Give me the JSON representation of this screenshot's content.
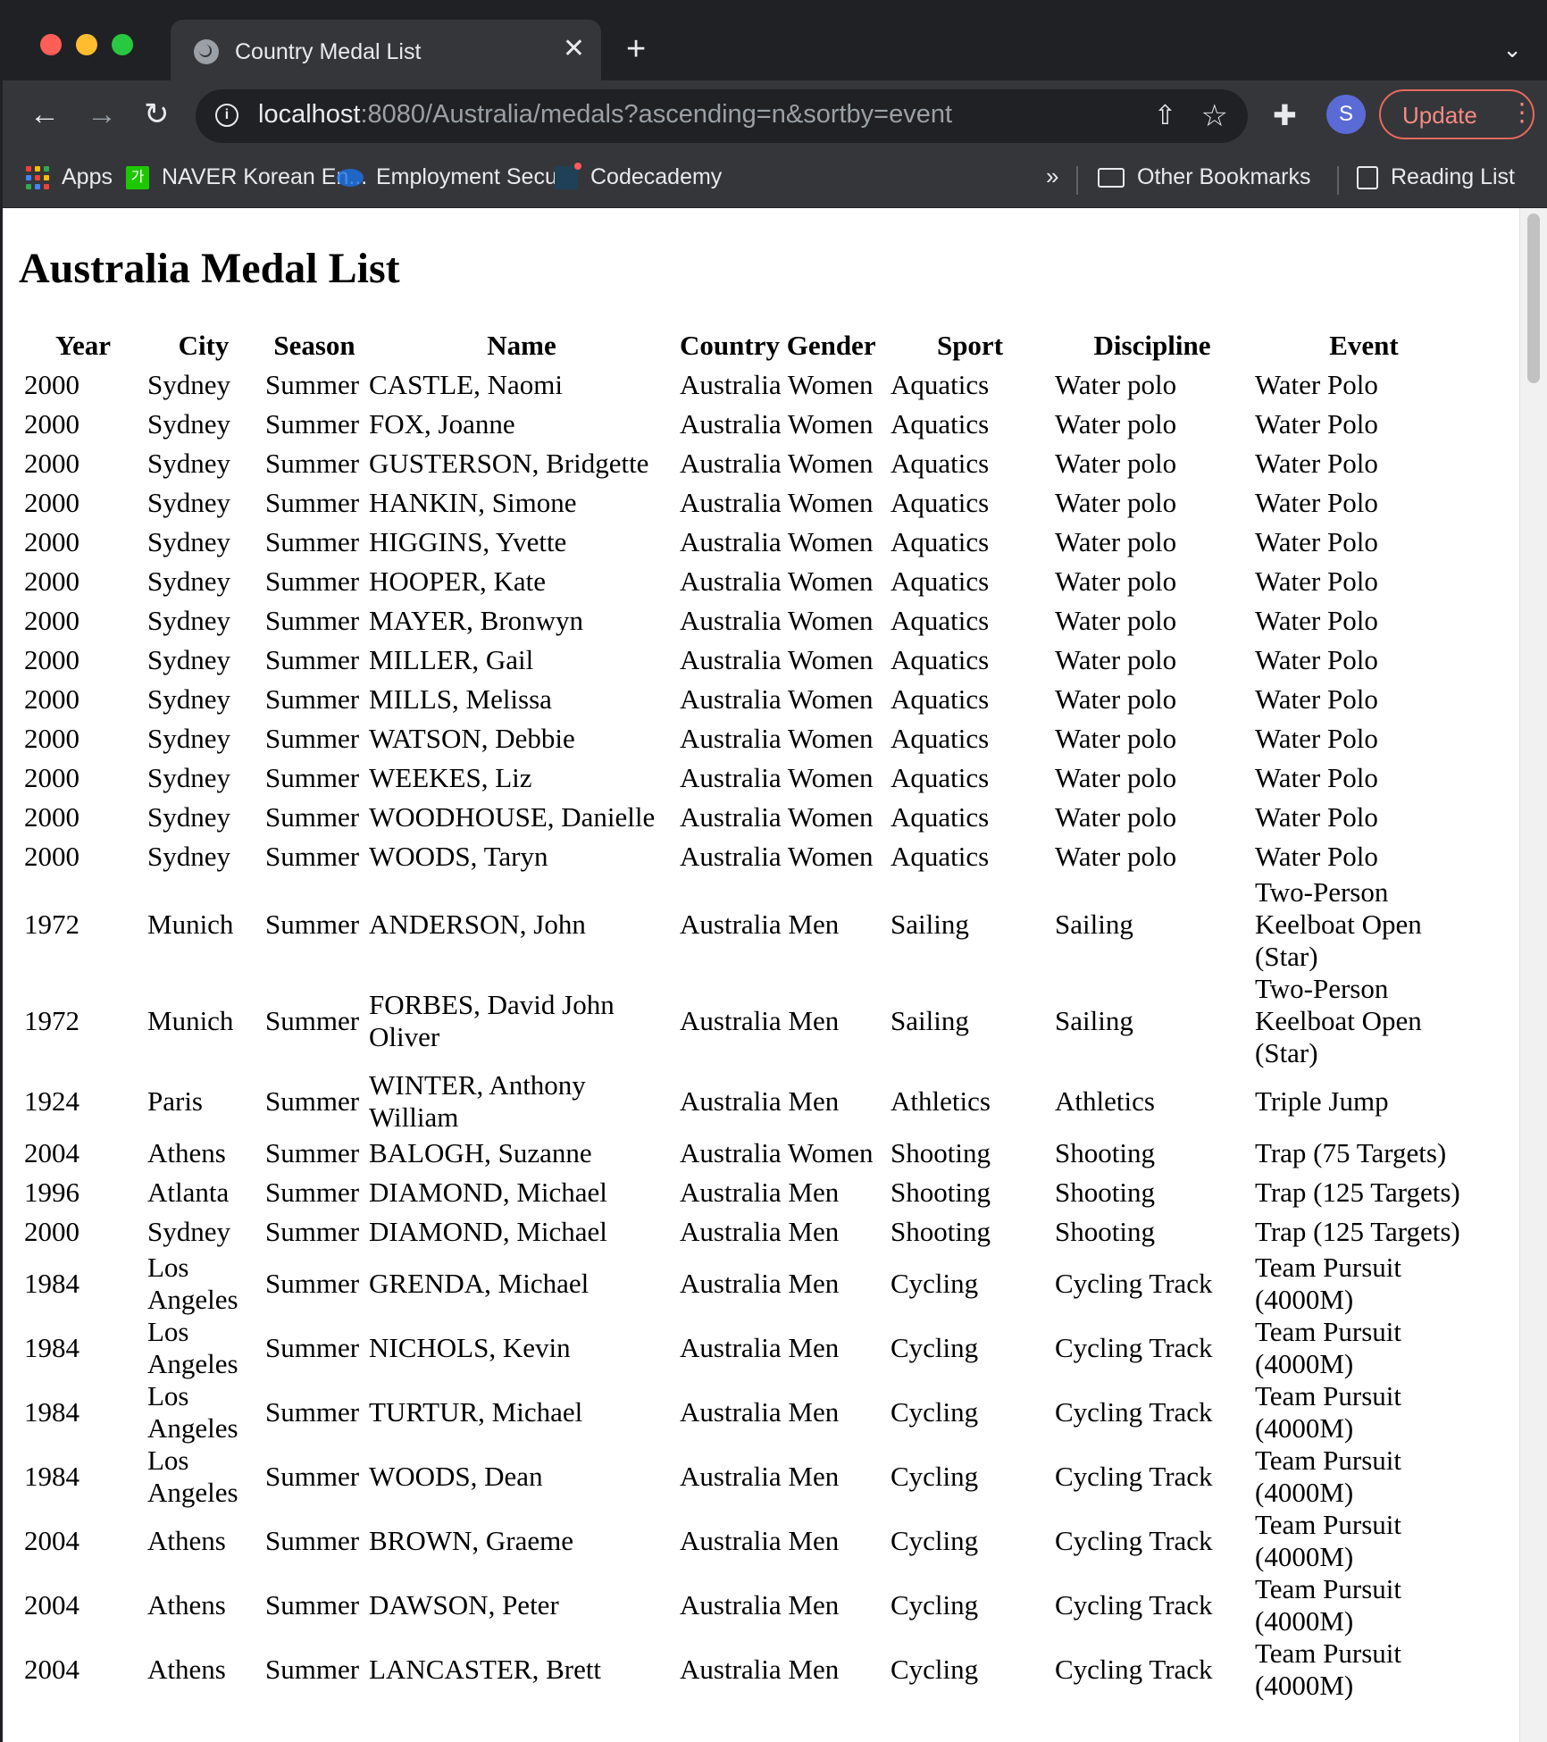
{
  "browser": {
    "tab_title": "Country Medal List",
    "url_host": "localhost",
    "url_rest": ":8080/Australia/medals?ascending=n&sortby=event",
    "avatar_letter": "S",
    "update_label": "Update",
    "bookmarks": {
      "apps": "Apps",
      "naver": "NAVER Korean En...",
      "employment": "Employment Secu...",
      "codecademy": "Codecademy",
      "more": "»",
      "other": "Other Bookmarks",
      "reading": "Reading List"
    }
  },
  "page": {
    "title": "Australia Medal List",
    "columns": [
      "Year",
      "City",
      "Season",
      "Name",
      "Country",
      "Gender",
      "Sport",
      "Discipline",
      "Event"
    ],
    "rows": [
      [
        "2000",
        "Sydney",
        "Summer",
        "CASTLE, Naomi",
        "Australia",
        "Women",
        "Aquatics",
        "Water polo",
        "Water Polo"
      ],
      [
        "2000",
        "Sydney",
        "Summer",
        "FOX, Joanne",
        "Australia",
        "Women",
        "Aquatics",
        "Water polo",
        "Water Polo"
      ],
      [
        "2000",
        "Sydney",
        "Summer",
        "GUSTERSON, Bridgette",
        "Australia",
        "Women",
        "Aquatics",
        "Water polo",
        "Water Polo"
      ],
      [
        "2000",
        "Sydney",
        "Summer",
        "HANKIN, Simone",
        "Australia",
        "Women",
        "Aquatics",
        "Water polo",
        "Water Polo"
      ],
      [
        "2000",
        "Sydney",
        "Summer",
        "HIGGINS, Yvette",
        "Australia",
        "Women",
        "Aquatics",
        "Water polo",
        "Water Polo"
      ],
      [
        "2000",
        "Sydney",
        "Summer",
        "HOOPER, Kate",
        "Australia",
        "Women",
        "Aquatics",
        "Water polo",
        "Water Polo"
      ],
      [
        "2000",
        "Sydney",
        "Summer",
        "MAYER, Bronwyn",
        "Australia",
        "Women",
        "Aquatics",
        "Water polo",
        "Water Polo"
      ],
      [
        "2000",
        "Sydney",
        "Summer",
        "MILLER, Gail",
        "Australia",
        "Women",
        "Aquatics",
        "Water polo",
        "Water Polo"
      ],
      [
        "2000",
        "Sydney",
        "Summer",
        "MILLS, Melissa",
        "Australia",
        "Women",
        "Aquatics",
        "Water polo",
        "Water Polo"
      ],
      [
        "2000",
        "Sydney",
        "Summer",
        "WATSON, Debbie",
        "Australia",
        "Women",
        "Aquatics",
        "Water polo",
        "Water Polo"
      ],
      [
        "2000",
        "Sydney",
        "Summer",
        "WEEKES, Liz",
        "Australia",
        "Women",
        "Aquatics",
        "Water polo",
        "Water Polo"
      ],
      [
        "2000",
        "Sydney",
        "Summer",
        "WOODHOUSE, Danielle",
        "Australia",
        "Women",
        "Aquatics",
        "Water polo",
        "Water Polo"
      ],
      [
        "2000",
        "Sydney",
        "Summer",
        "WOODS, Taryn",
        "Australia",
        "Women",
        "Aquatics",
        "Water polo",
        "Water Polo"
      ],
      [
        "1972",
        "Munich",
        "Summer",
        "ANDERSON, John",
        "Australia",
        "Men",
        "Sailing",
        "Sailing",
        "Two-Person Keelboat Open (Star)"
      ],
      [
        "1972",
        "Munich",
        "Summer",
        "FORBES, David John Oliver",
        "Australia",
        "Men",
        "Sailing",
        "Sailing",
        "Two-Person Keelboat Open (Star)"
      ],
      [
        "1924",
        "Paris",
        "Summer",
        "WINTER, Anthony William",
        "Australia",
        "Men",
        "Athletics",
        "Athletics",
        "Triple Jump"
      ],
      [
        "2004",
        "Athens",
        "Summer",
        "BALOGH, Suzanne",
        "Australia",
        "Women",
        "Shooting",
        "Shooting",
        "Trap (75 Targets)"
      ],
      [
        "1996",
        "Atlanta",
        "Summer",
        "DIAMOND, Michael",
        "Australia",
        "Men",
        "Shooting",
        "Shooting",
        "Trap (125 Targets)"
      ],
      [
        "2000",
        "Sydney",
        "Summer",
        "DIAMOND, Michael",
        "Australia",
        "Men",
        "Shooting",
        "Shooting",
        "Trap (125 Targets)"
      ],
      [
        "1984",
        "Los Angeles",
        "Summer",
        "GRENDA, Michael",
        "Australia",
        "Men",
        "Cycling",
        "Cycling Track",
        "Team Pursuit (4000M)"
      ],
      [
        "1984",
        "Los Angeles",
        "Summer",
        "NICHOLS, Kevin",
        "Australia",
        "Men",
        "Cycling",
        "Cycling Track",
        "Team Pursuit (4000M)"
      ],
      [
        "1984",
        "Los Angeles",
        "Summer",
        "TURTUR, Michael",
        "Australia",
        "Men",
        "Cycling",
        "Cycling Track",
        "Team Pursuit (4000M)"
      ],
      [
        "1984",
        "Los Angeles",
        "Summer",
        "WOODS, Dean",
        "Australia",
        "Men",
        "Cycling",
        "Cycling Track",
        "Team Pursuit (4000M)"
      ],
      [
        "2004",
        "Athens",
        "Summer",
        "BROWN, Graeme",
        "Australia",
        "Men",
        "Cycling",
        "Cycling Track",
        "Team Pursuit (4000M)"
      ],
      [
        "2004",
        "Athens",
        "Summer",
        "DAWSON, Peter",
        "Australia",
        "Men",
        "Cycling",
        "Cycling Track",
        "Team Pursuit (4000M)"
      ],
      [
        "2004",
        "Athens",
        "Summer",
        "LANCASTER, Brett",
        "Australia",
        "Men",
        "Cycling",
        "Cycling Track",
        "Team Pursuit (4000M)"
      ]
    ]
  }
}
